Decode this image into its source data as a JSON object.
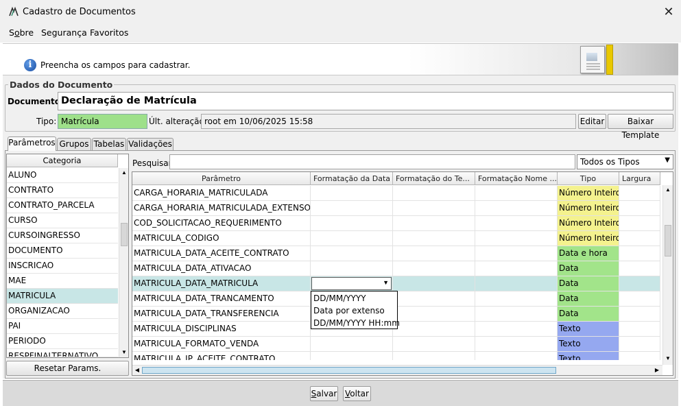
{
  "window": {
    "title": "Cadastro de Documentos",
    "close_glyph": "✕"
  },
  "menu": [
    "Sobre",
    "Segurança",
    "Favoritos"
  ],
  "banner": {
    "message": "Preencha os campos para cadastrar.",
    "icon": "info-icon",
    "icon_glyph": "i"
  },
  "dados": {
    "group_title": "Dados do Documento",
    "documento_label": "Documento:",
    "documento_value": "Declaração de Matrícula",
    "tipo_label": "Tipo:",
    "tipo_value": "Matrícula",
    "ult_label": "Últ. alteração:",
    "ult_value": "root em 10/06/2025 15:58",
    "editar_label": "Editar",
    "baixar_label": "Baixar Template"
  },
  "tabs": [
    "Parâmetros",
    "Grupos",
    "Tabelas",
    "Validações"
  ],
  "categoria": {
    "header": "Categoria",
    "items": [
      "ALUNO",
      "CONTRATO",
      "CONTRATO_PARCELA",
      "CURSO",
      "CURSOINGRESSO",
      "DOCUMENTO",
      "INSCRICAO",
      "MAE",
      "MATRICULA",
      "ORGANIZACAO",
      "PAI",
      "PERIODO",
      "RESPFINALTERNATIVO"
    ],
    "selected": "MATRICULA",
    "reset_label": "Resetar Params."
  },
  "search": {
    "label": "Pesquisar:",
    "value": "",
    "type_filter": "Todos os Tipos"
  },
  "grid": {
    "headers": [
      "Parâmetro",
      "Formatação da Data",
      "Formatação do Te...",
      "Formatação Nome ...",
      "Tipo",
      "Largura"
    ],
    "rows": [
      {
        "param": "CARGA_HORARIA_MATRICULADA",
        "tipo": "Número Inteiro"
      },
      {
        "param": "CARGA_HORARIA_MATRICULADA_EXTENSO",
        "tipo": "Número Inteiro"
      },
      {
        "param": "COD_SOLICITACAO_REQUERIMENTO",
        "tipo": "Número Inteiro"
      },
      {
        "param": "MATRICULA_CODIGO",
        "tipo": "Número Inteiro"
      },
      {
        "param": "MATRICULA_DATA_ACEITE_CONTRATO",
        "tipo": "Data e hora"
      },
      {
        "param": "MATRICULA_DATA_ATIVACAO",
        "tipo": "Data"
      },
      {
        "param": "MATRICULA_DATA_MATRICULA",
        "tipo": "Data"
      },
      {
        "param": "MATRICULA_DATA_TRANCAMENTO",
        "tipo": "Data"
      },
      {
        "param": "MATRICULA_DATA_TRANSFERENCIA",
        "tipo": "Data"
      },
      {
        "param": "MATRICULA_DISCIPLINAS",
        "tipo": "Texto"
      },
      {
        "param": "MATRICULA_FORMATO_VENDA",
        "tipo": "Texto"
      },
      {
        "param": "MATRICULA_IP_ACEITE_CONTRATO",
        "tipo": "Texto"
      }
    ],
    "selected_row": "MATRICULA_DATA_MATRICULA"
  },
  "date_format_dropdown": {
    "current": "",
    "options": [
      "DD/MM/YYYY",
      "Data por extenso",
      "DD/MM/YYYY HH:mm"
    ]
  },
  "type_colors": {
    "Número Inteiro": "#f4f28e",
    "Data": "#a2e48a",
    "Data e hora": "#a2e48a",
    "Texto": "#95a8f0"
  },
  "footer": {
    "salvar_label": "Salvar",
    "voltar_label": "Voltar"
  }
}
